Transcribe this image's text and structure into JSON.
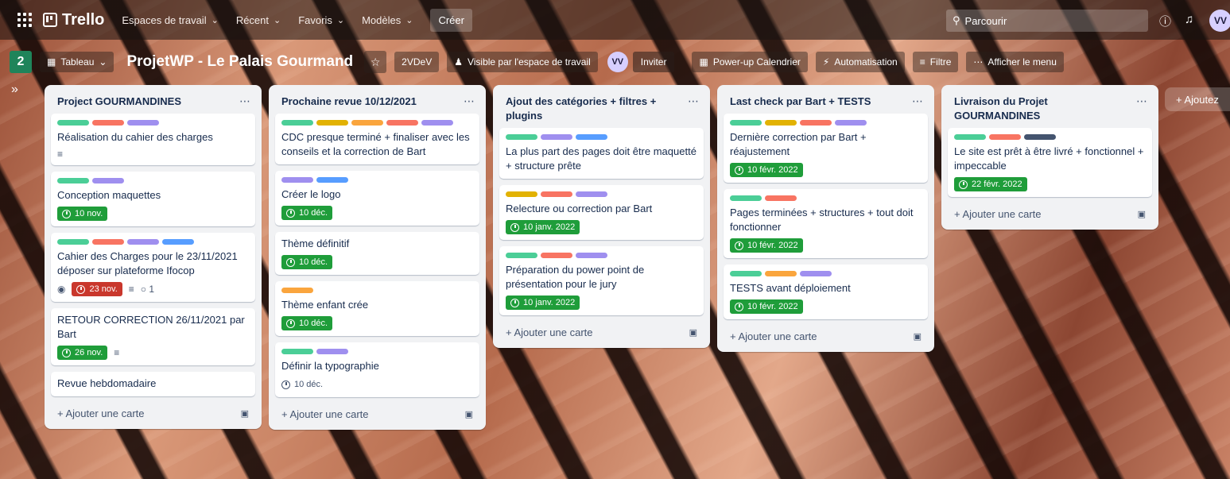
{
  "topbar": {
    "app_name": "Trello",
    "nav": [
      {
        "label": "Espaces de travail"
      },
      {
        "label": "Récent"
      },
      {
        "label": "Favoris"
      },
      {
        "label": "Modèles"
      }
    ],
    "create_label": "Créer",
    "search_placeholder": "Parcourir",
    "user_initials": "VV"
  },
  "boardbar": {
    "workspace_badge": "2",
    "view_label": "Tableau",
    "board_title": "ProjetWP - Le Palais Gourmand",
    "workspace_name": "2VDeV",
    "visibility_label": "Visible par l'espace de travail",
    "member_initials": "VV",
    "invite_label": "Inviter",
    "calendar_label": "Power-up Calendrier",
    "automation_label": "Automatisation",
    "filter_label": "Filtre",
    "menu_label": "Afficher le menu"
  },
  "colors": {
    "green": "#4bce97",
    "yellow": "#e2b203",
    "orange": "#faa53d",
    "red": "#f87462",
    "purple": "#9f8fef",
    "blue": "#579dff",
    "dark": "#44546f"
  },
  "add_card_label": "+ Ajouter une carte",
  "add_list_label": "+ Ajoutez",
  "lists": [
    {
      "title": "Project GOURMANDINES",
      "cards": [
        {
          "labels": [
            "green",
            "red",
            "purple"
          ],
          "title": "Réalisation du cahier des charges",
          "description": true
        },
        {
          "labels": [
            "green",
            "purple"
          ],
          "title": "Conception maquettes",
          "due": "10 nov.",
          "due_style": "green"
        },
        {
          "labels": [
            "green",
            "red",
            "purple",
            "blue"
          ],
          "title": "Cahier des Charges pour le 23/11/2021 déposer sur plateforme Ifocop",
          "watch": true,
          "due": "23 nov.",
          "due_style": "red",
          "description": true,
          "comments": "1"
        },
        {
          "labels": [],
          "title": "RETOUR CORRECTION 26/11/2021 par Bart",
          "due": "26 nov.",
          "due_style": "green",
          "description": true
        },
        {
          "labels": [],
          "title": "Revue hebdomadaire"
        }
      ]
    },
    {
      "title": "Prochaine revue 10/12/2021",
      "cards": [
        {
          "labels": [
            "green",
            "yellow",
            "orange",
            "red",
            "purple"
          ],
          "title": "CDC presque terminé + finaliser avec les conseils et la correction de Bart"
        },
        {
          "labels": [
            "purple",
            "blue"
          ],
          "title": "Créer le logo",
          "due": "10 déc.",
          "due_style": "green"
        },
        {
          "labels": [],
          "title": "Thème définitif",
          "due": "10 déc.",
          "due_style": "green"
        },
        {
          "labels": [
            "orange"
          ],
          "title": "Thème enfant crée",
          "due": "10 déc.",
          "due_style": "green"
        },
        {
          "labels": [
            "green",
            "purple"
          ],
          "title": "Définir la typographie",
          "due": "10 déc.",
          "due_style": "plain"
        }
      ]
    },
    {
      "title": "Ajout des catégories + filtres + plugins",
      "cards": [
        {
          "labels": [
            "green",
            "purple",
            "blue"
          ],
          "title": "La plus part des pages doit être maquetté + structure prête"
        },
        {
          "labels": [
            "yellow",
            "red",
            "purple"
          ],
          "title": "Relecture ou correction par Bart",
          "due": "10 janv. 2022",
          "due_style": "green"
        },
        {
          "labels": [
            "green",
            "red",
            "purple"
          ],
          "title": "Préparation du power point de présentation pour le jury",
          "due": "10 janv. 2022",
          "due_style": "green"
        }
      ]
    },
    {
      "title": "Last check par Bart + TESTS",
      "cards": [
        {
          "labels": [
            "green",
            "yellow",
            "red",
            "purple"
          ],
          "title": "Dernière correction par Bart + réajustement",
          "due": "10 févr. 2022",
          "due_style": "green"
        },
        {
          "labels": [
            "green",
            "red"
          ],
          "title": "Pages terminées + structures + tout doit fonctionner",
          "due": "10 févr. 2022",
          "due_style": "green"
        },
        {
          "labels": [
            "green",
            "orange",
            "purple"
          ],
          "title": "TESTS avant déploiement",
          "due": "10 févr. 2022",
          "due_style": "green"
        }
      ]
    },
    {
      "title": "Livraison du Projet GOURMANDINES",
      "cards": [
        {
          "labels": [
            "green",
            "red",
            "dark"
          ],
          "title": "Le site est prêt à être livré + fonctionnel + impeccable",
          "due": "22 févr. 2022",
          "due_style": "green"
        }
      ]
    }
  ]
}
